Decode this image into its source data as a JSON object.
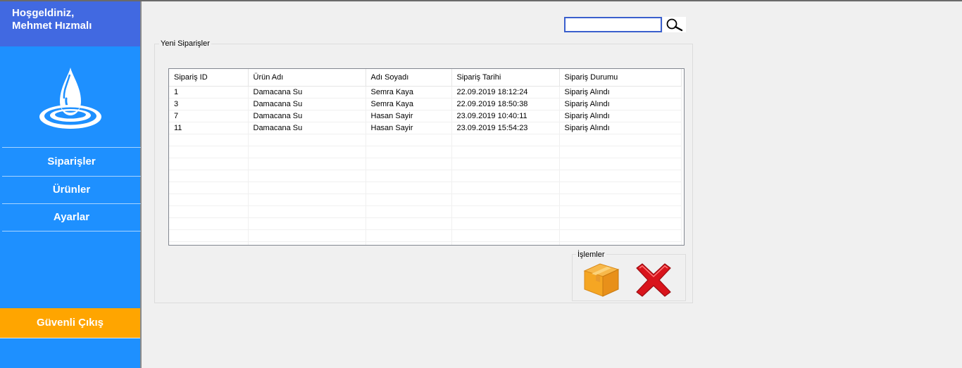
{
  "sidebar": {
    "welcome_line1": "Hoşgeldiniz,",
    "welcome_line2": "Mehmet Hızmalı",
    "items": [
      {
        "label": "Siparişler"
      },
      {
        "label": "Ürünler"
      },
      {
        "label": "Ayarlar"
      }
    ],
    "logout_label": "Güvenli Çıkış"
  },
  "search": {
    "value": "",
    "placeholder": ""
  },
  "orders_group": {
    "title": "Yeni Siparişler",
    "columns": [
      "Sipariş ID",
      "Ürün Adı",
      "Adı Soyadı",
      "Sipariş Tarihi",
      "Sipariş Durumu"
    ],
    "rows": [
      [
        "1",
        "Damacana Su",
        "Semra Kaya",
        "22.09.2019 18:12:24",
        "Sipariş Alındı"
      ],
      [
        "3",
        "Damacana Su",
        "Semra Kaya",
        "22.09.2019 18:50:38",
        "Sipariş Alındı"
      ],
      [
        "7",
        "Damacana Su",
        "Hasan Sayir",
        "23.09.2019 10:40:11",
        "Sipariş Alındı"
      ],
      [
        "11",
        "Damacana Su",
        "Hasan Sayir",
        "23.09.2019 15:54:23",
        "Sipariş Alındı"
      ]
    ]
  },
  "operations": {
    "title": "İşlemler",
    "buttons": [
      {
        "icon": "package-box-icon"
      },
      {
        "icon": "red-x-icon"
      }
    ]
  },
  "colors": {
    "sidebar": "#1e90ff",
    "welcome_bar": "#4169e1",
    "logout": "#ffa500"
  }
}
